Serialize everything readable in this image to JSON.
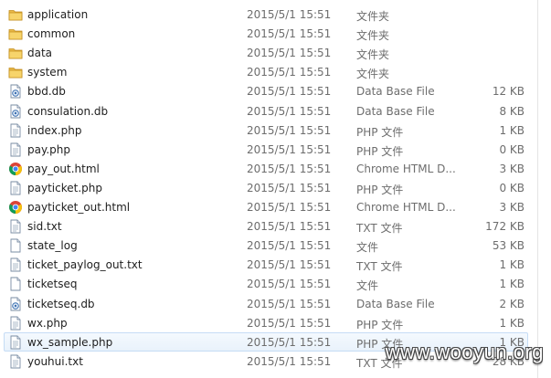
{
  "files": [
    {
      "name": "application",
      "date": "2015/5/1 15:51",
      "type": "文件夹",
      "size": "",
      "icon": "folder-icon"
    },
    {
      "name": "common",
      "date": "2015/5/1 15:51",
      "type": "文件夹",
      "size": "",
      "icon": "folder-icon"
    },
    {
      "name": "data",
      "date": "2015/5/1 15:51",
      "type": "文件夹",
      "size": "",
      "icon": "folder-icon"
    },
    {
      "name": "system",
      "date": "2015/5/1 15:51",
      "type": "文件夹",
      "size": "",
      "icon": "folder-icon"
    },
    {
      "name": "bbd.db",
      "date": "2015/5/1 15:51",
      "type": "Data Base File",
      "size": "12 KB",
      "icon": "database-file-icon"
    },
    {
      "name": "consulation.db",
      "date": "2015/5/1 15:51",
      "type": "Data Base File",
      "size": "8 KB",
      "icon": "database-file-icon"
    },
    {
      "name": "index.php",
      "date": "2015/5/1 15:51",
      "type": "PHP 文件",
      "size": "1 KB",
      "icon": "text-file-icon"
    },
    {
      "name": "pay.php",
      "date": "2015/5/1 15:51",
      "type": "PHP 文件",
      "size": "0 KB",
      "icon": "text-file-icon"
    },
    {
      "name": "pay_out.html",
      "date": "2015/5/1 15:51",
      "type": "Chrome HTML D...",
      "size": "3 KB",
      "icon": "chrome-icon"
    },
    {
      "name": "payticket.php",
      "date": "2015/5/1 15:51",
      "type": "PHP 文件",
      "size": "0 KB",
      "icon": "text-file-icon"
    },
    {
      "name": "payticket_out.html",
      "date": "2015/5/1 15:51",
      "type": "Chrome HTML D...",
      "size": "3 KB",
      "icon": "chrome-icon"
    },
    {
      "name": "sid.txt",
      "date": "2015/5/1 15:51",
      "type": "TXT 文件",
      "size": "172 KB",
      "icon": "text-file-icon"
    },
    {
      "name": "state_log",
      "date": "2015/5/1 15:51",
      "type": "文件",
      "size": "53 KB",
      "icon": "blank-file-icon"
    },
    {
      "name": "ticket_paylog_out.txt",
      "date": "2015/5/1 15:51",
      "type": "TXT 文件",
      "size": "1 KB",
      "icon": "text-file-icon"
    },
    {
      "name": "ticketseq",
      "date": "2015/5/1 15:51",
      "type": "文件",
      "size": "1 KB",
      "icon": "blank-file-icon"
    },
    {
      "name": "ticketseq.db",
      "date": "2015/5/1 15:51",
      "type": "Data Base File",
      "size": "2 KB",
      "icon": "database-file-icon"
    },
    {
      "name": "wx.php",
      "date": "2015/5/1 15:51",
      "type": "PHP 文件",
      "size": "1 KB",
      "icon": "text-file-icon"
    },
    {
      "name": "wx_sample.php",
      "date": "2015/5/1 15:51",
      "type": "PHP 文件",
      "size": "1 KB",
      "icon": "text-file-icon",
      "selected": true
    },
    {
      "name": "youhui.txt",
      "date": "2015/5/1 15:51",
      "type": "TXT 文件",
      "size": "28 KB",
      "icon": "text-file-icon"
    }
  ],
  "watermark": "www.wooyun.org"
}
